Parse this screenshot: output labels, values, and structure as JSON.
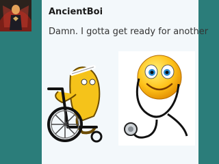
{
  "post": {
    "username": "AncientBoi",
    "message": "Damn. I gotta get ready for another"
  },
  "stickers": [
    {
      "name": "wheelchair-emoji"
    },
    {
      "name": "doctor-smiley-stethoscope"
    }
  ]
}
